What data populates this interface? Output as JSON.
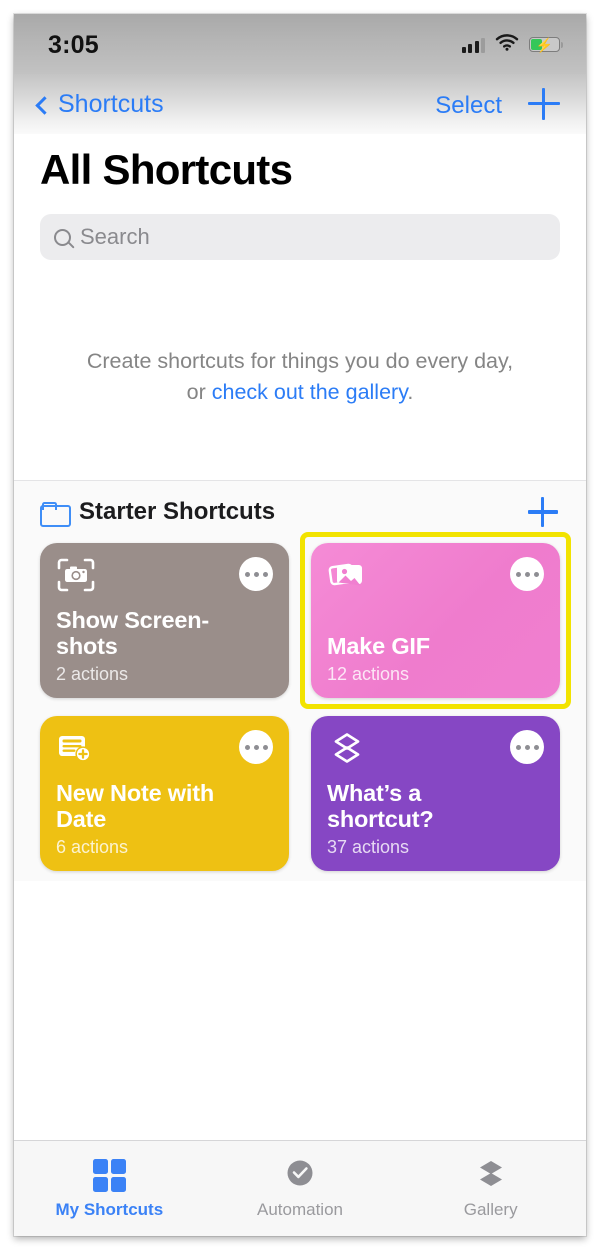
{
  "status_bar": {
    "time": "3:05",
    "signal_icon": "cellular-signal-icon",
    "wifi_icon": "wifi-icon",
    "battery_icon": "battery-charging-icon",
    "battery_level_percent": 35
  },
  "nav_bar": {
    "back_label": "Shortcuts",
    "back_icon": "chevron-left-icon",
    "select_label": "Select",
    "add_icon": "plus-icon",
    "tint_color": "#2b7cf6"
  },
  "page": {
    "title": "All Shortcuts"
  },
  "search": {
    "placeholder": "Search",
    "value": "",
    "icon": "search-icon"
  },
  "empty_state": {
    "line1": "Create shortcuts for things you do every day,",
    "prefix": "or ",
    "link": "check out the gallery",
    "suffix": "."
  },
  "folder_section": {
    "icon": "folder-icon",
    "title": "Starter Shortcuts",
    "add_icon": "plus-icon"
  },
  "cards": [
    {
      "name": "Show Screen-\nshots",
      "name_line1": "Show Screen-",
      "name_line2": "shots",
      "subtitle": "2 actions",
      "color": "#9a8e8a",
      "icon": "screenshot-camera-icon",
      "menu_icon": "ellipsis-icon",
      "selected": false
    },
    {
      "name": "Make GIF",
      "name_line1": "Make GIF",
      "name_line2": "",
      "subtitle": "12 actions",
      "color": "#f07fd0",
      "icon": "photo-stack-icon",
      "menu_icon": "ellipsis-icon",
      "selected": true,
      "highlight_color": "#f2e300"
    },
    {
      "name": "New Note with Date",
      "name_line1": "New Note with",
      "name_line2": "Date",
      "subtitle": "6 actions",
      "color": "#eec113",
      "icon": "new-note-icon",
      "menu_icon": "ellipsis-icon",
      "selected": false
    },
    {
      "name": "What’s a shortcut?",
      "name_line1": "What’s a",
      "name_line2": "shortcut?",
      "subtitle": "37 actions",
      "color": "#8647c4",
      "icon": "layers-icon",
      "menu_icon": "ellipsis-icon",
      "selected": false
    }
  ],
  "tab_bar": {
    "tabs": [
      {
        "label": "My Shortcuts",
        "icon": "grid-squares-icon",
        "active": true
      },
      {
        "label": "Automation",
        "icon": "clock-check-icon",
        "active": false
      },
      {
        "label": "Gallery",
        "icon": "layers-solid-icon",
        "active": false
      }
    ],
    "active_color": "#3b82f6",
    "inactive_color": "#9a9a9e"
  }
}
